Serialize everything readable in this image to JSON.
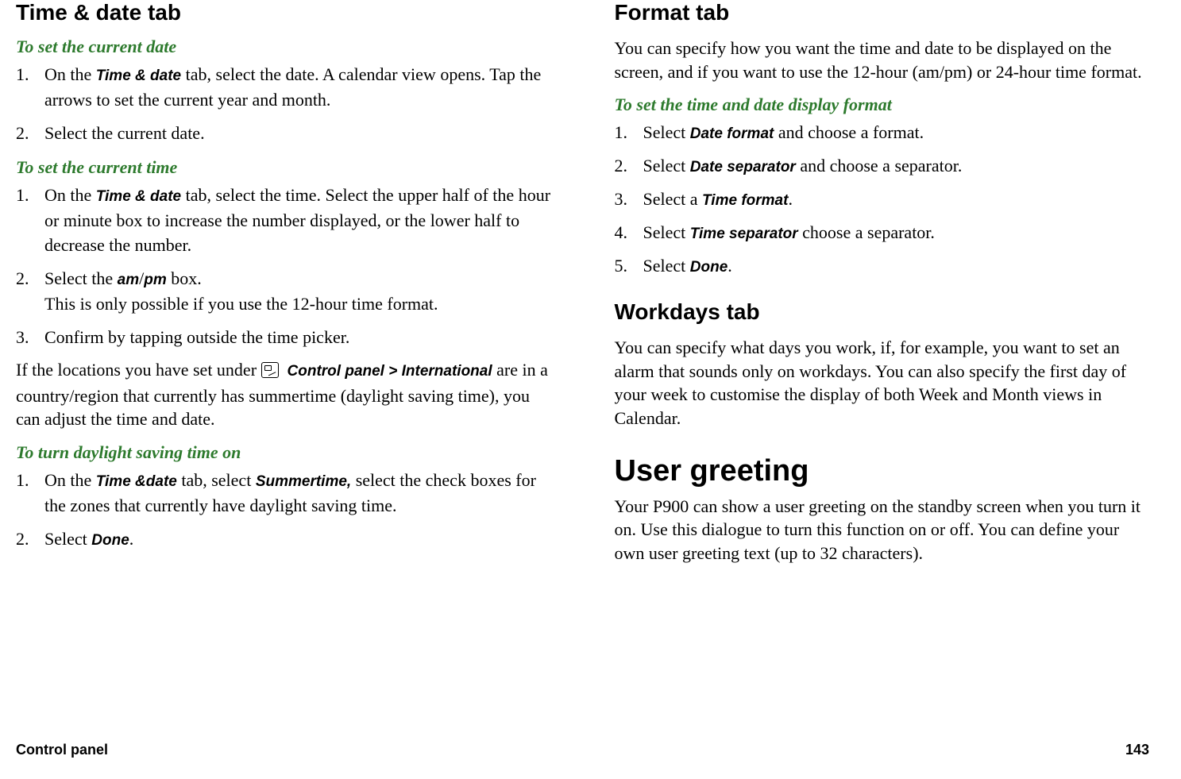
{
  "left": {
    "heading_time_date_tab": "Time & date tab",
    "task_set_current_date": "To set the current date",
    "steps_set_date": [
      {
        "pre": "On the ",
        "ui": "Time & date",
        "post": " tab, select the date. A calendar view opens. Tap the arrows to set the current year and month."
      },
      {
        "text": "Select the current date."
      }
    ],
    "task_set_current_time": "To set the current time",
    "steps_set_time": [
      {
        "pre": "On the ",
        "ui": "Time & date",
        "post": " tab, select the time. Select the upper half of the hour or minute box to increase the number displayed, or the lower half to decrease the number."
      },
      {
        "pre": "Select the ",
        "ui": "am",
        "mid": "/",
        "ui2": "pm",
        "post": " box.",
        "note": "This is only possible if you use the 12-hour time format."
      },
      {
        "text": "Confirm by tapping outside the time picker."
      }
    ],
    "dst_para_pre": "If the locations you have set under ",
    "dst_icon_label": "Control panel > International",
    "dst_para_post": " are in a country/region that currently has summertime (daylight saving time), you can adjust the time and date.",
    "task_dst_on": "To turn daylight saving time on",
    "steps_dst": [
      {
        "pre": "On the ",
        "ui": "Time &date",
        "post": " tab, select ",
        "ui2": "Summertime,",
        "post2": " select the check boxes for the zones that currently have daylight saving time."
      },
      {
        "pre": " Select ",
        "ui": "Done",
        "post": "."
      }
    ]
  },
  "right": {
    "heading_format_tab": "Format tab",
    "format_intro": "You can specify how you want the time and date to be displayed on the screen, and if you want to use the 12-hour (am/pm) or 24-hour time format.",
    "task_set_display_format": "To set the time and date display format",
    "steps_format": [
      {
        "pre": "Select ",
        "ui": "Date format",
        "post": " and choose a format."
      },
      {
        "pre": "Select ",
        "ui": "Date separator",
        "post": " and choose a separator."
      },
      {
        "pre": "Select a ",
        "ui": "Time format",
        "post": "."
      },
      {
        "pre": "Select ",
        "ui": "Time separator",
        "post": "  choose a separator."
      },
      {
        "pre": "Select ",
        "ui": "Done",
        "post": "."
      }
    ],
    "heading_workdays_tab": "Workdays tab",
    "workdays_para": "You can specify what days you work, if, for example, you want to set an alarm that sounds only on workdays. You can also specify the first day of your week to customise the display of both Week and Month views in Calendar.",
    "heading_user_greeting": "User greeting",
    "user_greeting_para": "Your P900 can show a user greeting on the standby screen when you turn it on. Use this dialogue to turn this function on or off. You can define your own user greeting text (up to 32 characters)."
  },
  "footer": {
    "left": "Control panel",
    "right": "143"
  }
}
